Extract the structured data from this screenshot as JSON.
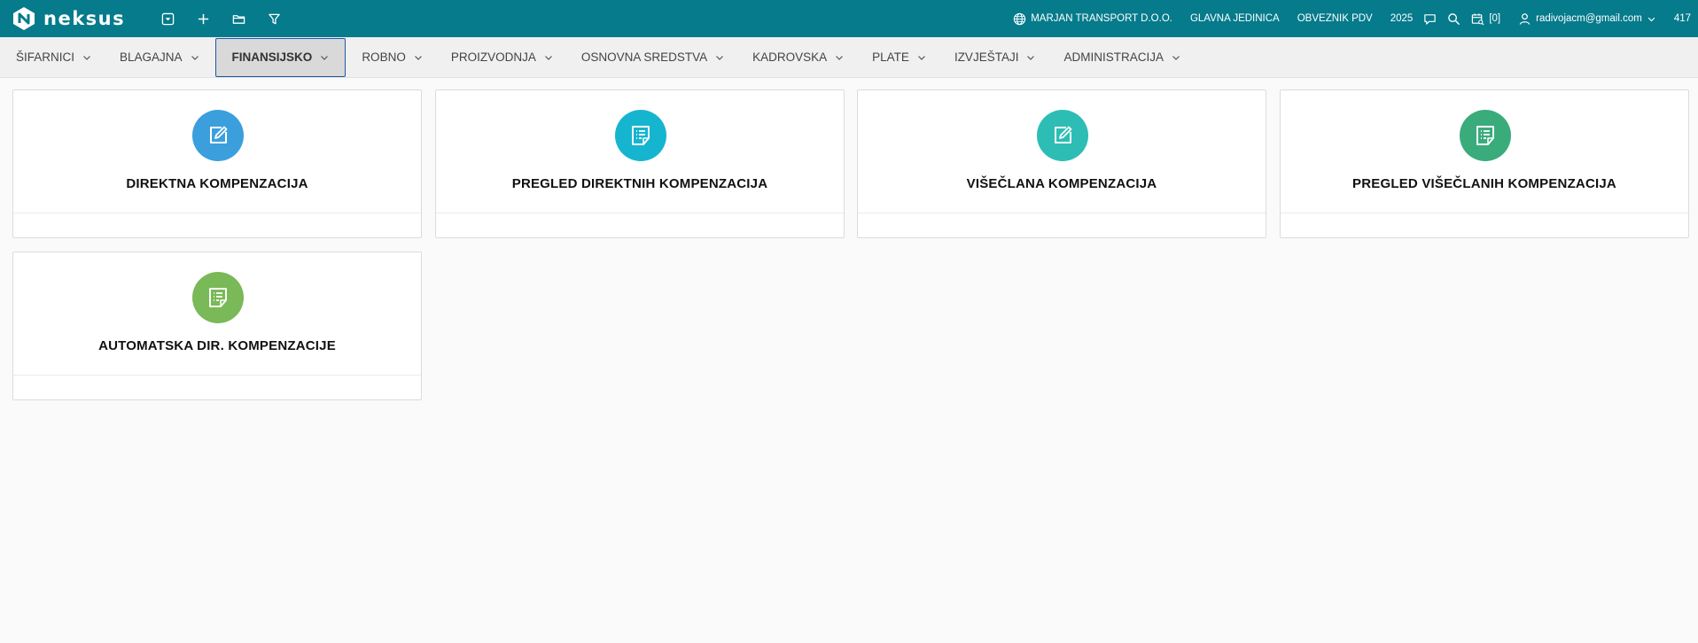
{
  "brand": {
    "name": "neksus"
  },
  "topbar": {
    "company": "MARJAN TRANSPORT D.O.O.",
    "unit": "GLAVNA JEDINICA",
    "vat": "OBVEZNIK PDV",
    "year": "2025",
    "cart_count": "[0]",
    "user_email": "radivojacm@gmail.com",
    "user_id": "417"
  },
  "menu": {
    "items": [
      {
        "label": "ŠIFARNICI"
      },
      {
        "label": "BLAGAJNA"
      },
      {
        "label": "FINANSIJSKO"
      },
      {
        "label": "ROBNO"
      },
      {
        "label": "PROIZVODNJA"
      },
      {
        "label": "OSNOVNA SREDSTVA"
      },
      {
        "label": "KADROVSKA"
      },
      {
        "label": "PLATE"
      },
      {
        "label": "IZVJEŠTAJI"
      },
      {
        "label": "ADMINISTRACIJA"
      }
    ],
    "active": "FINANSIJSKO"
  },
  "cards": [
    {
      "title": "DIREKTNA KOMPENZACIJA",
      "icon": "edit-icon",
      "color": "#3b9fdd"
    },
    {
      "title": "PREGLED DIREKTNIH KOMPENZACIJA",
      "icon": "list-icon",
      "color": "#16b5cf"
    },
    {
      "title": "VIŠEČLANA KOMPENZACIJA",
      "icon": "edit-icon",
      "color": "#2dbdb5"
    },
    {
      "title": "PREGLED VIŠEČLANIH KOMPENZACIJA",
      "icon": "list-icon",
      "color": "#3aac7c"
    },
    {
      "title": "AUTOMATSKA DIR. KOMPENZACIJE",
      "icon": "list-icon",
      "color": "#79b957"
    }
  ],
  "colors": {
    "topbar": "#057b8b",
    "active_menu_border": "#1d56a8"
  }
}
